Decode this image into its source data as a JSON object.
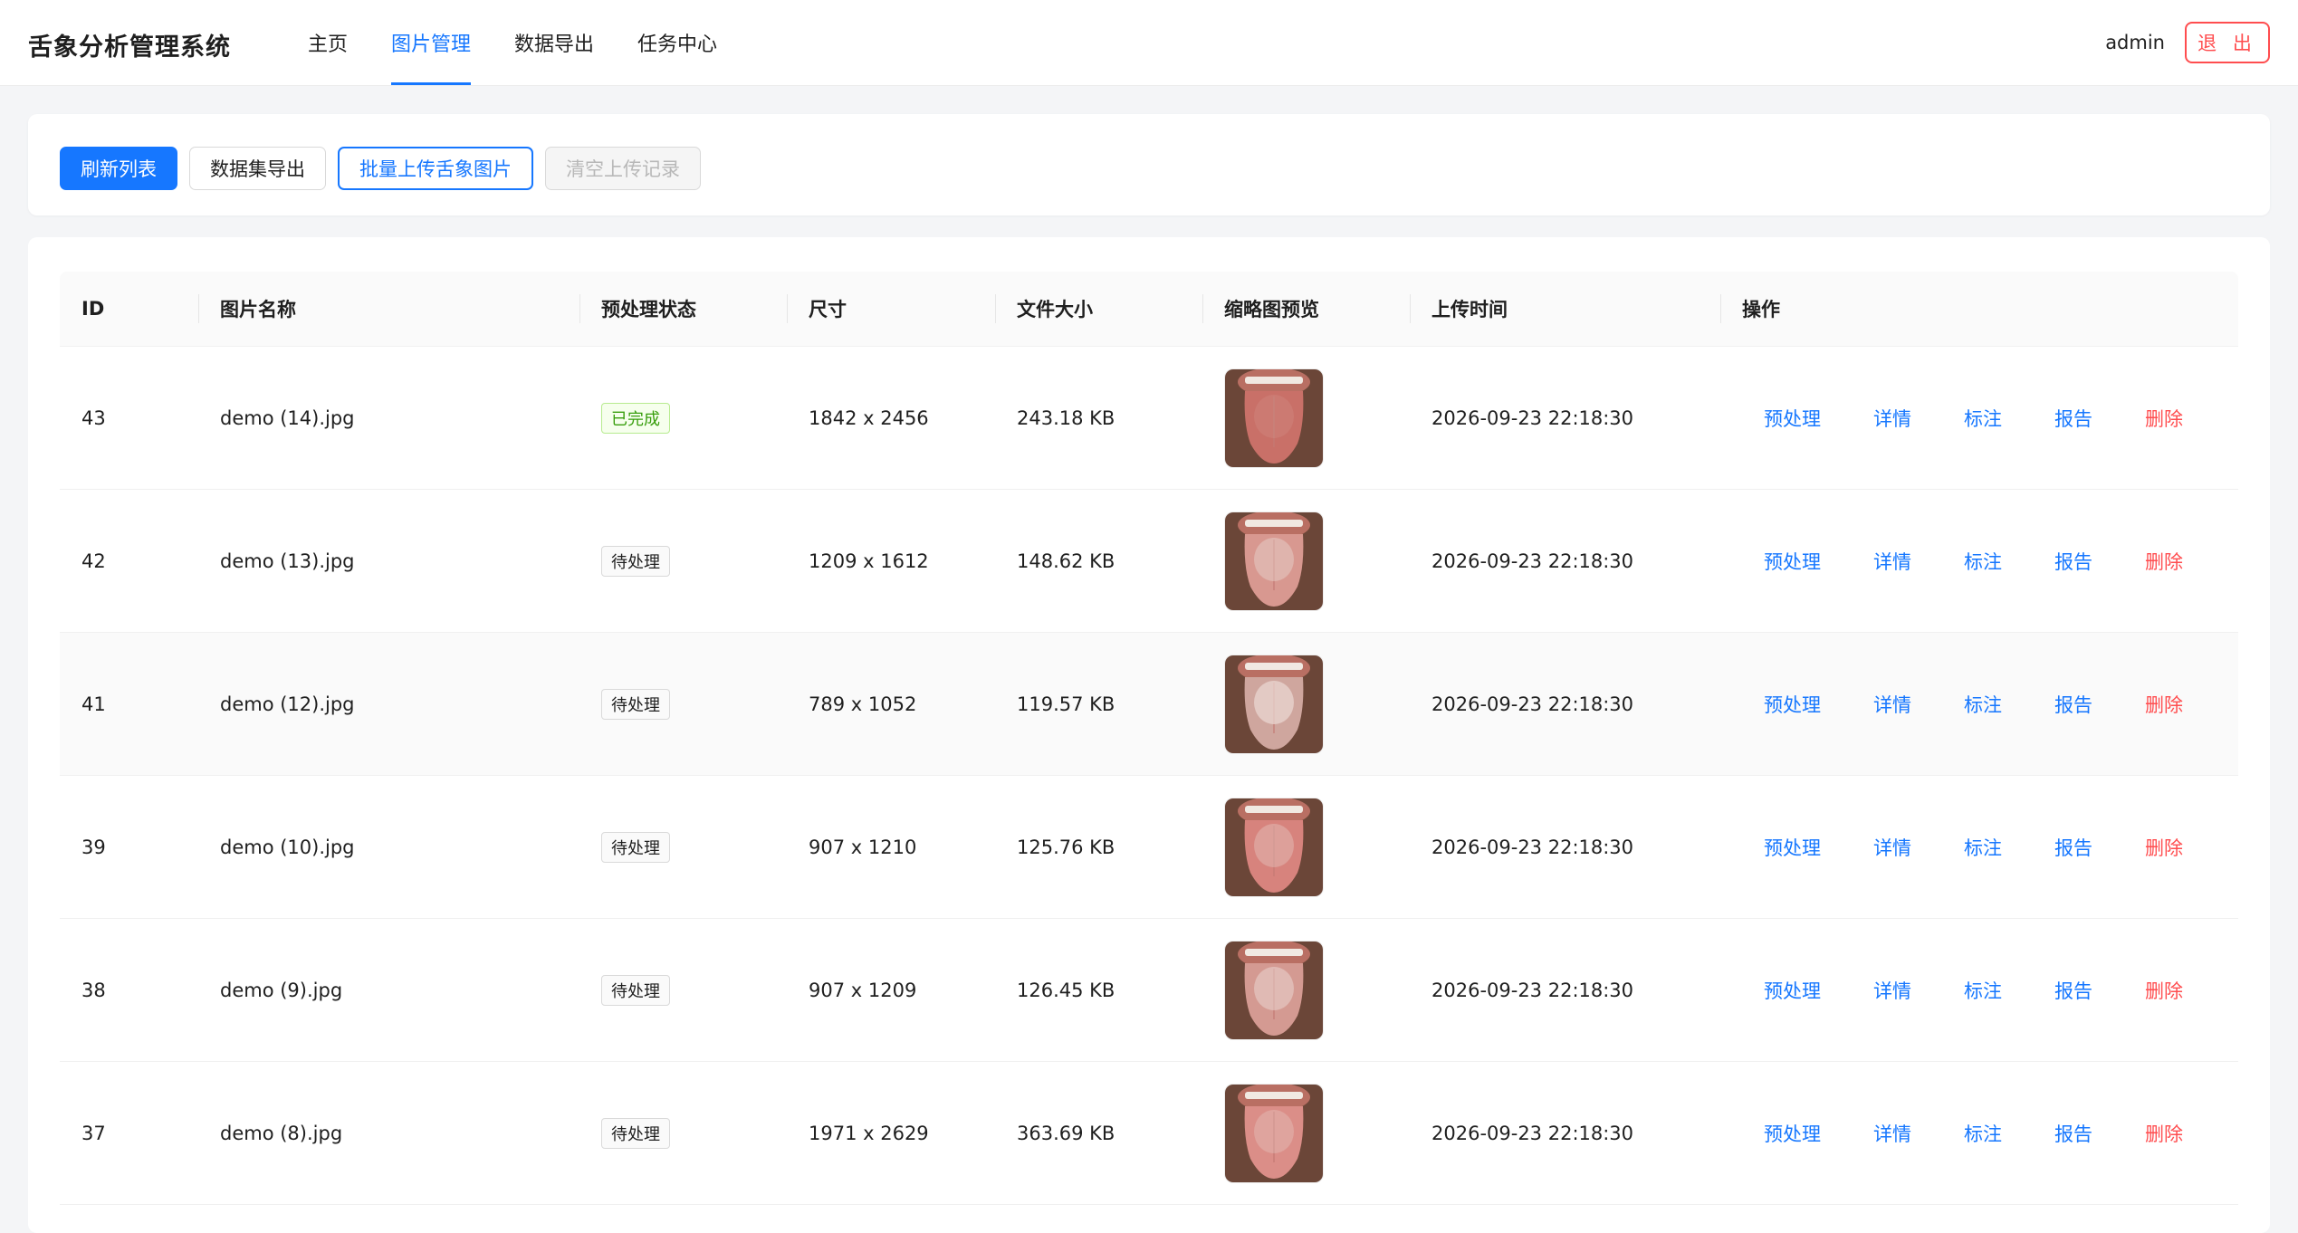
{
  "app": {
    "title": "舌象分析管理系统"
  },
  "nav": [
    {
      "label": "主页",
      "active": false
    },
    {
      "label": "图片管理",
      "active": true
    },
    {
      "label": "数据导出",
      "active": false
    },
    {
      "label": "任务中心",
      "active": false
    }
  ],
  "user": {
    "name": "admin",
    "logout_label": "退 出"
  },
  "toolbar": {
    "refresh_label": "刷新列表",
    "export_label": "数据集导出",
    "upload_label": "批量上传舌象图片",
    "clear_label": "清空上传记录"
  },
  "table": {
    "headers": {
      "id": "ID",
      "name": "图片名称",
      "status": "预处理状态",
      "size": "尺寸",
      "filesize": "文件大小",
      "thumb": "缩略图预览",
      "time": "上传时间",
      "ops": "操作"
    },
    "rows": [
      {
        "id": "43",
        "name": "demo (14).jpg",
        "status": "已完成",
        "status_type": "done",
        "size": "1842 x 2456",
        "filesize": "243.18 KB",
        "time": "2026-09-23 22:18:30"
      },
      {
        "id": "42",
        "name": "demo (13).jpg",
        "status": "待处理",
        "status_type": "pending",
        "size": "1209 x 1612",
        "filesize": "148.62 KB",
        "time": "2026-09-23 22:18:30"
      },
      {
        "id": "41",
        "name": "demo (12).jpg",
        "status": "待处理",
        "status_type": "pending",
        "size": "789 x 1052",
        "filesize": "119.57 KB",
        "time": "2026-09-23 22:18:30"
      },
      {
        "id": "39",
        "name": "demo (10).jpg",
        "status": "待处理",
        "status_type": "pending",
        "size": "907 x 1210",
        "filesize": "125.76 KB",
        "time": "2026-09-23 22:18:30"
      },
      {
        "id": "38",
        "name": "demo (9).jpg",
        "status": "待处理",
        "status_type": "pending",
        "size": "907 x 1209",
        "filesize": "126.45 KB",
        "time": "2026-09-23 22:18:30"
      },
      {
        "id": "37",
        "name": "demo (8).jpg",
        "status": "待处理",
        "status_type": "pending",
        "size": "1971 x 2629",
        "filesize": "363.69 KB",
        "time": "2026-09-23 22:18:30"
      }
    ],
    "actions": {
      "preprocess": "预处理",
      "detail": "详情",
      "annotate": "标注",
      "report": "报告",
      "delete": "删除"
    }
  },
  "colors": {
    "primary": "#1677ff",
    "danger": "#ff4d4f",
    "success": "#389e0d"
  }
}
